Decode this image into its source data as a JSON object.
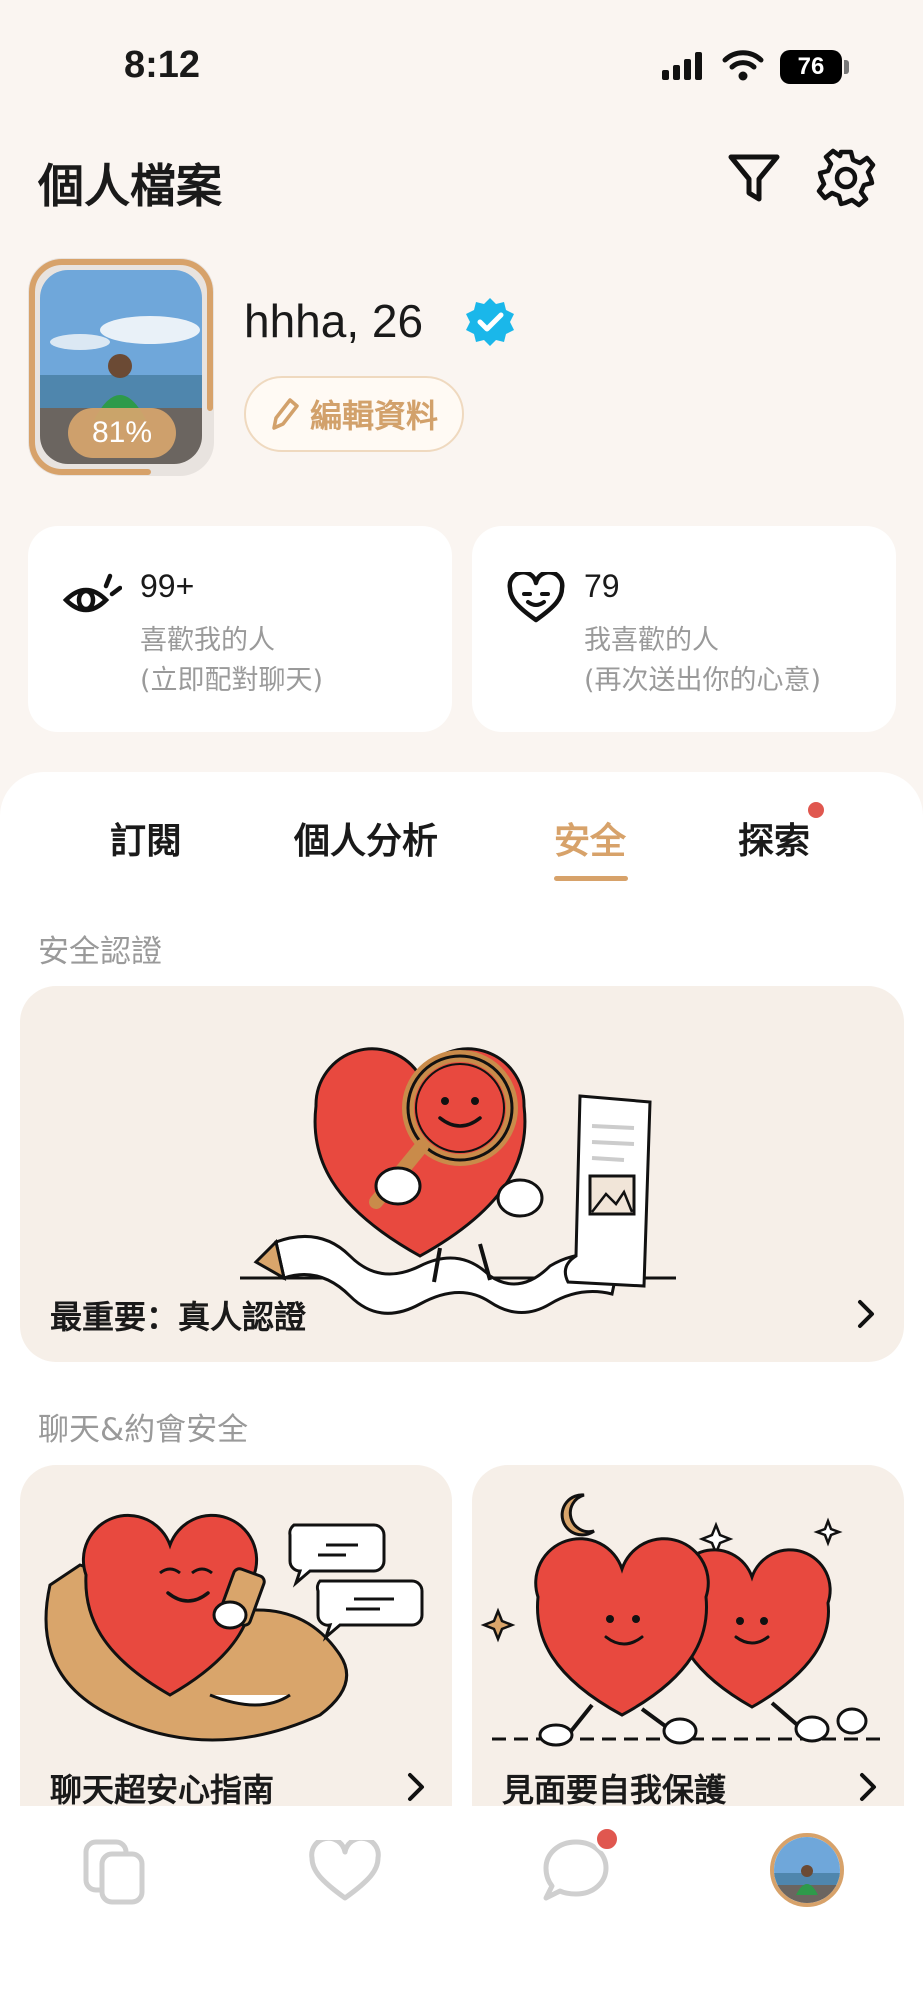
{
  "status_bar": {
    "time": "8:12",
    "battery": "76"
  },
  "header": {
    "title": "個人檔案"
  },
  "profile": {
    "name": "hhha, 26",
    "completion": "81%",
    "edit_label": "編輯資料"
  },
  "stats": {
    "likes_me": {
      "count": "99+",
      "label": "喜歡我的人",
      "sub": "(立即配對聊天)"
    },
    "i_like": {
      "count": "79",
      "label": "我喜歡的人",
      "sub": "(再次送出你的心意)"
    }
  },
  "tabs": [
    {
      "label": "訂閱"
    },
    {
      "label": "個人分析"
    },
    {
      "label": "安全"
    },
    {
      "label": "探索"
    }
  ],
  "sections": {
    "verification": {
      "title": "安全認證",
      "card_label": "最重要：真人認證"
    },
    "dating_safety": {
      "title": "聊天&約會安全",
      "cards": [
        {
          "label": "聊天超安心指南"
        },
        {
          "label": "見面要自我保護"
        }
      ]
    }
  },
  "colors": {
    "accent": "#d7a26a",
    "heart_red": "#e8493f",
    "verified_blue": "#1ab7ea",
    "card_bg": "#f6efe8",
    "notification_red": "#e0574f"
  }
}
